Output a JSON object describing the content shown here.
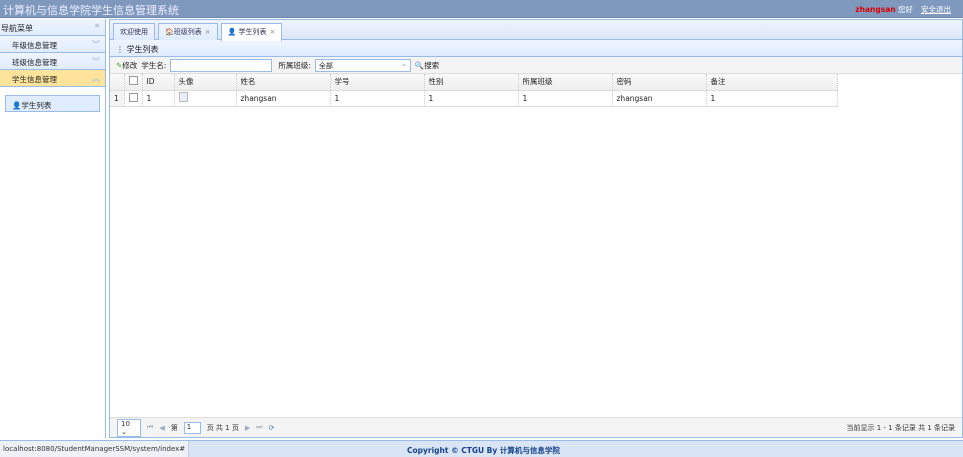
{
  "header": {
    "title": "计算机与信息学院学生信息管理系统",
    "username": "zhangsan",
    "greeting": "您好",
    "logout": "安全退出"
  },
  "sidebar": {
    "title": "导航菜单",
    "collapse": "«",
    "items": [
      {
        "label": "年级信息管理"
      },
      {
        "label": "班级信息管理"
      },
      {
        "label": "学生信息管理"
      }
    ],
    "sub_items": [
      {
        "label": "学生列表"
      }
    ]
  },
  "tabs": [
    {
      "label": "欢迎使用"
    },
    {
      "label": "班级列表"
    },
    {
      "label": "学生列表"
    }
  ],
  "panel": {
    "title": "学生列表"
  },
  "toolbar": {
    "edit": "修改",
    "name_label": "学生名:",
    "name_value": "",
    "class_label": "所属班级:",
    "class_value": "全部",
    "search": "搜索"
  },
  "table": {
    "columns": [
      "ID",
      "头像",
      "姓名",
      "学号",
      "性别",
      "所属班级",
      "密码",
      "备注"
    ],
    "rows": [
      {
        "num": "1",
        "id": "1",
        "name": "zhangsan",
        "sn": "1",
        "sex": "1",
        "clazz": "1",
        "password": "zhangsan",
        "remark": "1"
      }
    ]
  },
  "pager": {
    "page_size": "10",
    "page_prefix": "第",
    "page": "1",
    "page_suffix": "页 共 1 页",
    "info": "当前显示 1 - 1 条记录 共 1 条记录"
  },
  "footer": {
    "url": "localhost:8080/StudentManagerSSM/system/index#",
    "copyright": "Copyright © CTGU By 计算机与信息学院"
  }
}
